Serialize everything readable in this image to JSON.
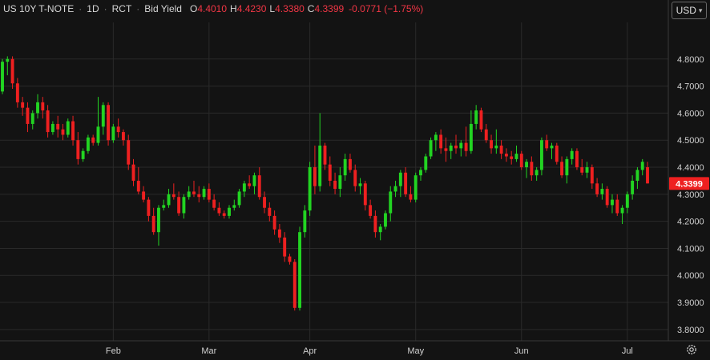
{
  "legend": {
    "symbol": "US 10Y T-NOTE",
    "interval": "1D",
    "source": "RCT",
    "quote": "Bid Yield",
    "open_label": "O",
    "open": "4.4010",
    "high_label": "H",
    "high": "4.4230",
    "low_label": "L",
    "low": "4.3380",
    "close_label": "C",
    "close": "4.3399",
    "change": "-0.0771 (−1.75%)"
  },
  "currency": {
    "label": "USD",
    "chevron_icon": "chevron-down-icon"
  },
  "settings_icon": "gear-icon",
  "colors": {
    "up": "#22d422",
    "down": "#ee2020",
    "background": "#131313",
    "grid": "#2a2a2a",
    "last_price_bg": "#ee2020"
  },
  "chart_data": {
    "type": "candlestick",
    "y_ticks": [
      "4.8000",
      "4.7000",
      "4.6000",
      "4.5000",
      "4.4000",
      "4.3000",
      "4.2000",
      "4.1000",
      "4.0000",
      "3.9000",
      "3.8000"
    ],
    "ylim": [
      3.77,
      4.9
    ],
    "x_ticks": [
      {
        "label": "Feb",
        "index": 22
      },
      {
        "label": "Mar",
        "index": 41
      },
      {
        "label": "Apr",
        "index": 61
      },
      {
        "label": "May",
        "index": 82
      },
      {
        "label": "Jun",
        "index": 103
      },
      {
        "label": "Jul",
        "index": 124
      }
    ],
    "last_price": "4.3399",
    "last_value": 4.3399,
    "candles": [
      [
        4.68,
        4.8,
        4.67,
        4.79
      ],
      [
        4.79,
        4.81,
        4.74,
        4.8
      ],
      [
        4.8,
        4.81,
        4.69,
        4.71
      ],
      [
        4.71,
        4.73,
        4.62,
        4.64
      ],
      [
        4.64,
        4.66,
        4.59,
        4.62
      ],
      [
        4.62,
        4.64,
        4.53,
        4.56
      ],
      [
        4.56,
        4.61,
        4.54,
        4.6
      ],
      [
        4.6,
        4.67,
        4.58,
        4.64
      ],
      [
        4.64,
        4.66,
        4.58,
        4.61
      ],
      [
        4.61,
        4.63,
        4.51,
        4.53
      ],
      [
        4.53,
        4.57,
        4.52,
        4.56
      ],
      [
        4.56,
        4.59,
        4.51,
        4.54
      ],
      [
        4.54,
        4.56,
        4.5,
        4.52
      ],
      [
        4.52,
        4.58,
        4.51,
        4.57
      ],
      [
        4.57,
        4.59,
        4.48,
        4.5
      ],
      [
        4.5,
        4.53,
        4.41,
        4.43
      ],
      [
        4.43,
        4.47,
        4.42,
        4.46
      ],
      [
        4.46,
        4.52,
        4.45,
        4.51
      ],
      [
        4.51,
        4.52,
        4.48,
        4.49
      ],
      [
        4.49,
        4.66,
        4.48,
        4.55
      ],
      [
        4.55,
        4.64,
        4.52,
        4.63
      ],
      [
        4.63,
        4.64,
        4.48,
        4.5
      ],
      [
        4.5,
        4.56,
        4.49,
        4.55
      ],
      [
        4.55,
        4.58,
        4.51,
        4.53
      ],
      [
        4.53,
        4.54,
        4.48,
        4.5
      ],
      [
        4.5,
        4.52,
        4.39,
        4.41
      ],
      [
        4.41,
        4.43,
        4.33,
        4.35
      ],
      [
        4.35,
        4.4,
        4.3,
        4.31
      ],
      [
        4.31,
        4.33,
        4.27,
        4.28
      ],
      [
        4.28,
        4.29,
        4.2,
        4.22
      ],
      [
        4.22,
        4.25,
        4.15,
        4.16
      ],
      [
        4.16,
        4.26,
        4.11,
        4.25
      ],
      [
        4.25,
        4.28,
        4.24,
        4.26
      ],
      [
        4.26,
        4.32,
        4.25,
        4.3
      ],
      [
        4.3,
        4.34,
        4.28,
        4.29
      ],
      [
        4.29,
        4.31,
        4.22,
        4.23
      ],
      [
        4.23,
        4.3,
        4.21,
        4.29
      ],
      [
        4.29,
        4.33,
        4.28,
        4.31
      ],
      [
        4.31,
        4.35,
        4.29,
        4.3
      ],
      [
        4.3,
        4.33,
        4.27,
        4.29
      ],
      [
        4.29,
        4.33,
        4.28,
        4.32
      ],
      [
        4.32,
        4.34,
        4.27,
        4.28
      ],
      [
        4.28,
        4.3,
        4.24,
        4.25
      ],
      [
        4.25,
        4.27,
        4.22,
        4.23
      ],
      [
        4.23,
        4.24,
        4.21,
        4.22
      ],
      [
        4.22,
        4.26,
        4.21,
        4.25
      ],
      [
        4.25,
        4.28,
        4.24,
        4.26
      ],
      [
        4.26,
        4.32,
        4.25,
        4.31
      ],
      [
        4.31,
        4.35,
        4.29,
        4.34
      ],
      [
        4.34,
        4.37,
        4.32,
        4.33
      ],
      [
        4.33,
        4.38,
        4.3,
        4.37
      ],
      [
        4.37,
        4.4,
        4.28,
        4.29
      ],
      [
        4.29,
        4.31,
        4.23,
        4.25
      ],
      [
        4.25,
        4.27,
        4.2,
        4.22
      ],
      [
        4.22,
        4.24,
        4.15,
        4.17
      ],
      [
        4.17,
        4.19,
        4.12,
        4.14
      ],
      [
        4.14,
        4.16,
        4.05,
        4.07
      ],
      [
        4.07,
        4.08,
        4.04,
        4.05
      ],
      [
        4.05,
        4.06,
        3.87,
        3.88
      ],
      [
        3.88,
        4.18,
        3.87,
        4.16
      ],
      [
        4.16,
        4.26,
        4.14,
        4.24
      ],
      [
        4.24,
        4.42,
        4.22,
        4.4
      ],
      [
        4.4,
        4.48,
        4.3,
        4.33
      ],
      [
        4.33,
        4.6,
        4.31,
        4.48
      ],
      [
        4.48,
        4.49,
        4.39,
        4.41
      ],
      [
        4.41,
        4.44,
        4.33,
        4.35
      ],
      [
        4.35,
        4.38,
        4.3,
        4.32
      ],
      [
        4.32,
        4.4,
        4.29,
        4.37
      ],
      [
        4.37,
        4.45,
        4.35,
        4.43
      ],
      [
        4.43,
        4.45,
        4.38,
        4.39
      ],
      [
        4.39,
        4.41,
        4.31,
        4.33
      ],
      [
        4.33,
        4.36,
        4.3,
        4.34
      ],
      [
        4.34,
        4.35,
        4.24,
        4.26
      ],
      [
        4.26,
        4.28,
        4.21,
        4.22
      ],
      [
        4.22,
        4.24,
        4.14,
        4.16
      ],
      [
        4.16,
        4.19,
        4.13,
        4.18
      ],
      [
        4.18,
        4.24,
        4.17,
        4.23
      ],
      [
        4.23,
        4.33,
        4.2,
        4.31
      ],
      [
        4.31,
        4.35,
        4.29,
        4.33
      ],
      [
        4.33,
        4.39,
        4.29,
        4.38
      ],
      [
        4.38,
        4.4,
        4.29,
        4.3
      ],
      [
        4.3,
        4.33,
        4.27,
        4.28
      ],
      [
        4.28,
        4.38,
        4.27,
        4.37
      ],
      [
        4.37,
        4.4,
        4.35,
        4.39
      ],
      [
        4.39,
        4.45,
        4.38,
        4.44
      ],
      [
        4.44,
        4.51,
        4.43,
        4.5
      ],
      [
        4.5,
        4.53,
        4.46,
        4.52
      ],
      [
        4.52,
        4.54,
        4.45,
        4.47
      ],
      [
        4.47,
        4.51,
        4.42,
        4.46
      ],
      [
        4.46,
        4.49,
        4.43,
        4.48
      ],
      [
        4.48,
        4.52,
        4.45,
        4.47
      ],
      [
        4.47,
        4.5,
        4.44,
        4.49
      ],
      [
        4.49,
        4.55,
        4.44,
        4.46
      ],
      [
        4.46,
        4.61,
        4.45,
        4.56
      ],
      [
        4.56,
        4.63,
        4.54,
        4.61
      ],
      [
        4.61,
        4.62,
        4.53,
        4.54
      ],
      [
        4.54,
        4.56,
        4.49,
        4.5
      ],
      [
        4.5,
        4.52,
        4.45,
        4.47
      ],
      [
        4.47,
        4.54,
        4.45,
        4.48
      ],
      [
        4.48,
        4.5,
        4.43,
        4.45
      ],
      [
        4.45,
        4.47,
        4.42,
        4.44
      ],
      [
        4.44,
        4.46,
        4.41,
        4.43
      ],
      [
        4.43,
        4.48,
        4.42,
        4.45
      ],
      [
        4.45,
        4.46,
        4.39,
        4.4
      ],
      [
        4.4,
        4.43,
        4.36,
        4.42
      ],
      [
        4.42,
        4.44,
        4.35,
        4.37
      ],
      [
        4.37,
        4.4,
        4.35,
        4.39
      ],
      [
        4.39,
        4.51,
        4.37,
        4.5
      ],
      [
        4.5,
        4.52,
        4.46,
        4.47
      ],
      [
        4.47,
        4.49,
        4.43,
        4.48
      ],
      [
        4.48,
        4.49,
        4.41,
        4.42
      ],
      [
        4.42,
        4.44,
        4.36,
        4.37
      ],
      [
        4.37,
        4.44,
        4.34,
        4.43
      ],
      [
        4.43,
        4.47,
        4.41,
        4.46
      ],
      [
        4.46,
        4.47,
        4.39,
        4.4
      ],
      [
        4.4,
        4.43,
        4.37,
        4.38
      ],
      [
        4.38,
        4.42,
        4.36,
        4.4
      ],
      [
        4.4,
        4.41,
        4.32,
        4.34
      ],
      [
        4.34,
        4.36,
        4.29,
        4.3
      ],
      [
        4.3,
        4.34,
        4.28,
        4.32
      ],
      [
        4.32,
        4.33,
        4.25,
        4.26
      ],
      [
        4.26,
        4.3,
        4.23,
        4.28
      ],
      [
        4.28,
        4.3,
        4.22,
        4.23
      ],
      [
        4.23,
        4.26,
        4.19,
        4.25
      ],
      [
        4.25,
        4.31,
        4.23,
        4.3
      ],
      [
        4.3,
        4.37,
        4.28,
        4.35
      ],
      [
        4.35,
        4.4,
        4.32,
        4.39
      ],
      [
        4.39,
        4.43,
        4.37,
        4.42
      ],
      [
        4.4,
        4.42,
        4.34,
        4.34
      ]
    ]
  }
}
